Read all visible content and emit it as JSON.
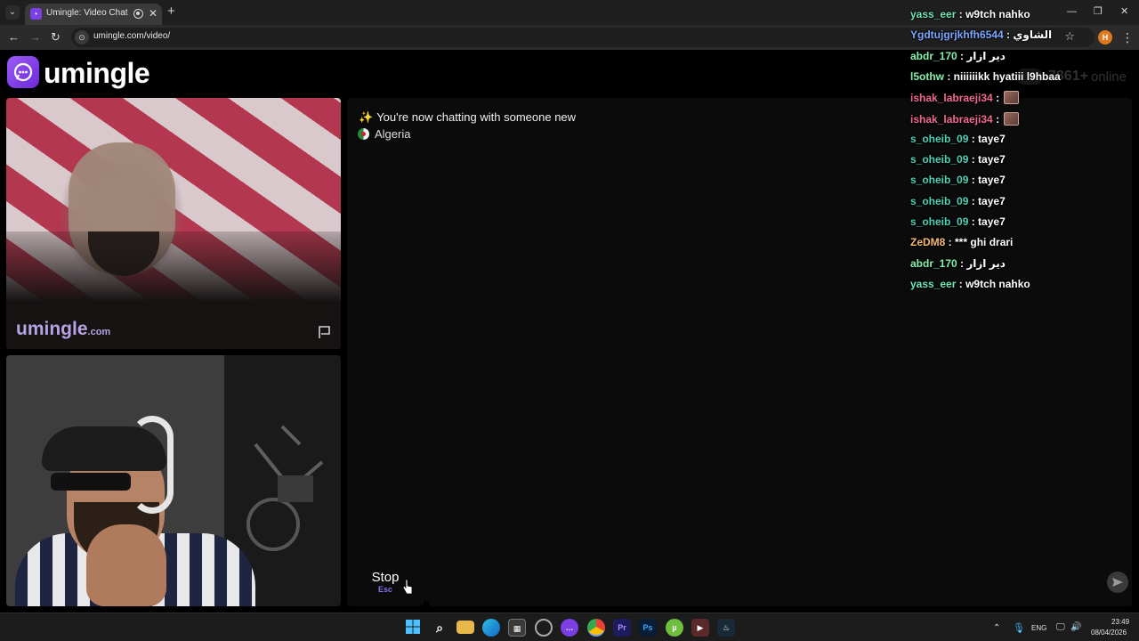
{
  "browser": {
    "tab_title": "Umingle: Video Chat with S",
    "url": "umingle.com/video/",
    "profile_initial": "H"
  },
  "site": {
    "logo_text": "umingle",
    "online_count": "7861+",
    "online_label": "online",
    "watermark": "umingle",
    "watermark_domain": ".com"
  },
  "chat": {
    "system_message": "You're now chatting with someone new",
    "country": "Algeria",
    "stop_label": "Stop",
    "stop_key": "Esc",
    "input_placeholder": ""
  },
  "stream_chat": [
    {
      "user": "yass_eer",
      "text": "w9tch nahko",
      "color": "#6ee7b7"
    },
    {
      "user": "Ygdtujgrjkhfh6544",
      "text": "الشاوي",
      "color": "#7aa7ff"
    },
    {
      "user": "abdr_170",
      "text": "دير ازار",
      "color": "#86efac"
    },
    {
      "user": "l5othw",
      "text": "niiiiiikk hyatiii l9hbaa",
      "color": "#86efac"
    },
    {
      "user": "ishak_labraeji34",
      "text": "",
      "color": "#f06a8f",
      "emote": true
    },
    {
      "user": "ishak_labraeji34",
      "text": "",
      "color": "#f06a8f",
      "emote": true
    },
    {
      "user": "s_oheib_09",
      "text": "taye7",
      "color": "#4fd1b5"
    },
    {
      "user": "s_oheib_09",
      "text": "taye7",
      "color": "#4fd1b5"
    },
    {
      "user": "s_oheib_09",
      "text": "taye7",
      "color": "#4fd1b5"
    },
    {
      "user": "s_oheib_09",
      "text": "taye7",
      "color": "#4fd1b5"
    },
    {
      "user": "s_oheib_09",
      "text": "taye7",
      "color": "#4fd1b5"
    },
    {
      "user": "ZeDM8",
      "text": "*** ghi drari",
      "color": "#f5b971"
    },
    {
      "user": "abdr_170",
      "text": "دير ازار",
      "color": "#86efac"
    },
    {
      "user": "yass_eer",
      "text": "w9tch nahko",
      "color": "#6ee7b7"
    }
  ],
  "taskbar": {
    "language": "ENG",
    "time": "23:49",
    "date": "08/04/2026",
    "apps": [
      "windows-start-icon",
      "search-icon",
      "file-explorer-icon",
      "edge-icon",
      "store-icon",
      "app-icon",
      "chat-app-icon",
      "chrome-icon",
      "premiere-icon",
      "photoshop-icon",
      "utorrent-icon",
      "media-player-icon",
      "steam-icon"
    ]
  },
  "colors": {
    "accent": "#7b3fe4",
    "panel": "#0b0b0b",
    "background": "#000000"
  }
}
